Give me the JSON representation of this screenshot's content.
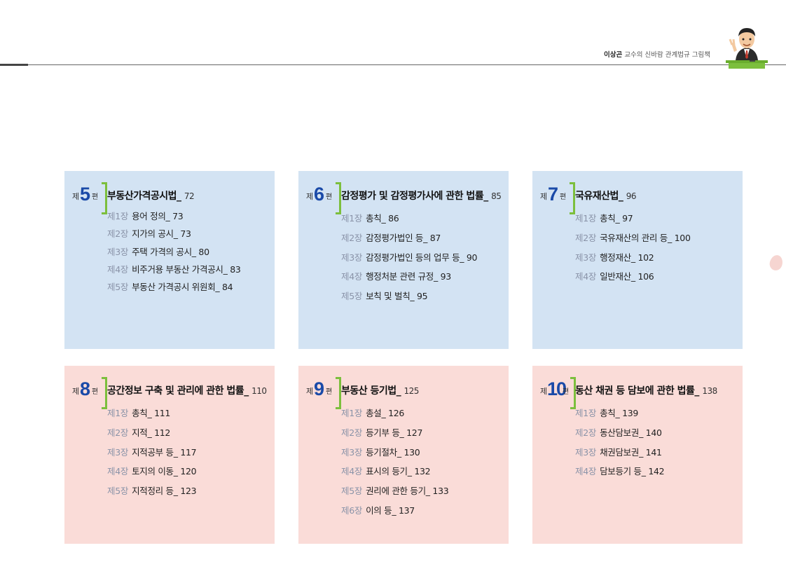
{
  "header": {
    "author": "이상곤",
    "subtitle": "교수의 신바람 관계법규 그림책"
  },
  "parts": [
    {
      "prefix": "제",
      "number": "5",
      "suffix": "편",
      "title": "부동산가격공시법_",
      "page": "72",
      "theme": "blue",
      "chapters": [
        {
          "num": "제1장",
          "title": "용어 정의_ 73"
        },
        {
          "num": "제2장",
          "title": "지가의 공시_ 73"
        },
        {
          "num": "제3장",
          "title": "주택 가격의 공시_ 80"
        },
        {
          "num": "제4장",
          "title": "비주거용 부동산 가격공시_ 83"
        },
        {
          "num": "제5장",
          "title": "부동산 가격공시 위원회_ 84"
        }
      ]
    },
    {
      "prefix": "제",
      "number": "6",
      "suffix": "편",
      "title": "감정평가 및 감정평가사에 관한 법률_",
      "page": "85",
      "theme": "blue",
      "chapters": [
        {
          "num": "제1장",
          "title": "총칙_ 86"
        },
        {
          "num": "제2장",
          "title": "감정평가법인 등_ 87"
        },
        {
          "num": "제3장",
          "title": "감정평가법인 등의 업무 등_ 90"
        },
        {
          "num": "제4장",
          "title": "행정처분 관련 규정_ 93"
        },
        {
          "num": "제5장",
          "title": "보칙 및 벌칙_ 95"
        }
      ]
    },
    {
      "prefix": "제",
      "number": "7",
      "suffix": "편",
      "title": "국유재산법_",
      "page": "96",
      "theme": "blue",
      "chapters": [
        {
          "num": "제1장",
          "title": "총칙_ 97"
        },
        {
          "num": "제2장",
          "title": "국유재산의 관리 등_ 100"
        },
        {
          "num": "제3장",
          "title": "행정재산_ 102"
        },
        {
          "num": "제4장",
          "title": "일반재산_ 106"
        }
      ]
    },
    {
      "prefix": "제",
      "number": "8",
      "suffix": "편",
      "title": "공간정보 구축 및 관리에 관한 법률_",
      "page": "110",
      "theme": "pink",
      "chapters": [
        {
          "num": "제1장",
          "title": "총칙_ 111"
        },
        {
          "num": "제2장",
          "title": "지적_ 112"
        },
        {
          "num": "제3장",
          "title": "지적공부 등_ 117"
        },
        {
          "num": "제4장",
          "title": "토지의 이동_ 120"
        },
        {
          "num": "제5장",
          "title": "지적정리 등_ 123"
        }
      ]
    },
    {
      "prefix": "제",
      "number": "9",
      "suffix": "편",
      "title": "부동산 등기법_",
      "page": "125",
      "theme": "pink",
      "chapters": [
        {
          "num": "제1장",
          "title": "총설_ 126"
        },
        {
          "num": "제2장",
          "title": "등기부 등_ 127"
        },
        {
          "num": "제3장",
          "title": "등기절차_ 130"
        },
        {
          "num": "제4장",
          "title": "표시의 등기_ 132"
        },
        {
          "num": "제5장",
          "title": "권리에 관한 등기_ 133"
        },
        {
          "num": "제6장",
          "title": "이의 등_ 137"
        }
      ]
    },
    {
      "prefix": "제",
      "number": "10",
      "suffix": "편",
      "title": "동산 채권 등 담보에 관한 법률_",
      "page": "138",
      "theme": "pink",
      "chapters": [
        {
          "num": "제1장",
          "title": "총칙_ 139"
        },
        {
          "num": "제2장",
          "title": "동산담보권_ 140"
        },
        {
          "num": "제3장",
          "title": "채권담보권_ 141"
        },
        {
          "num": "제4장",
          "title": "담보등기 등_ 142"
        }
      ]
    }
  ]
}
